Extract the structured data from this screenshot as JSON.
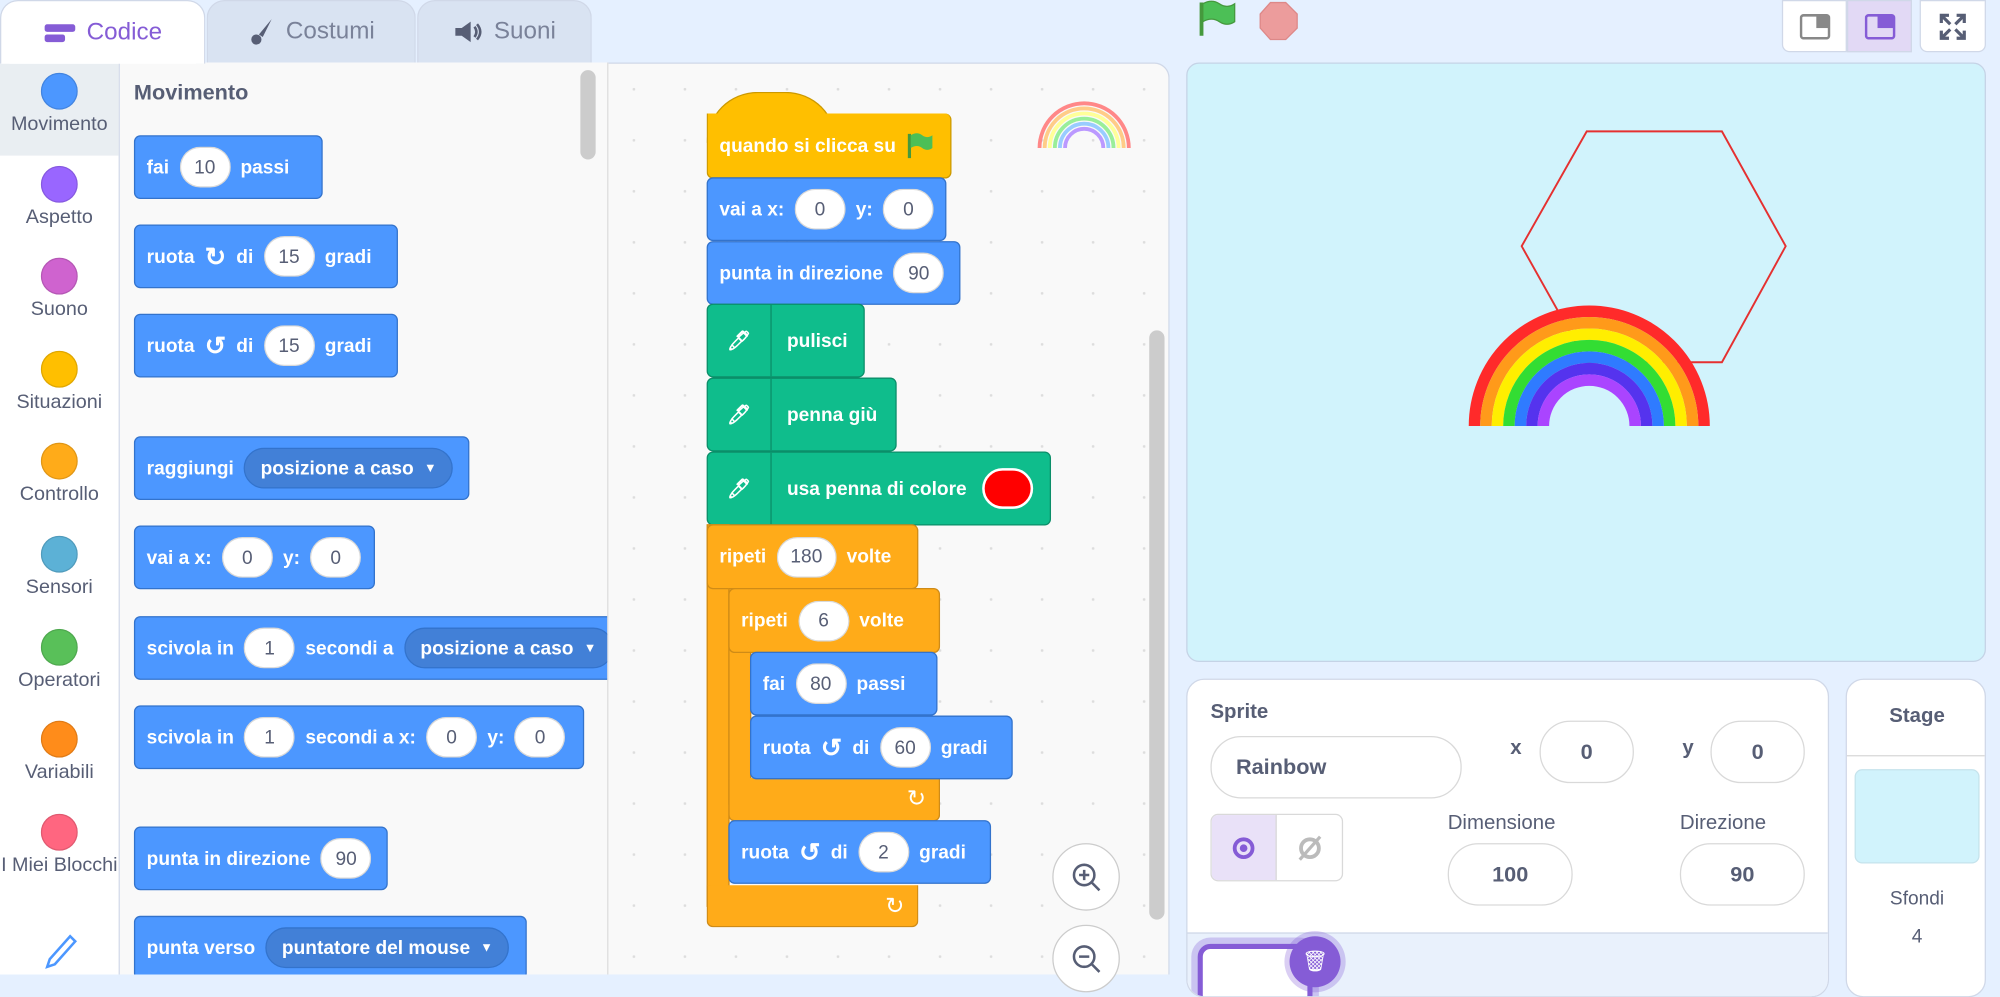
{
  "tabs": [
    {
      "label": "Codice",
      "icon": "code-icon"
    },
    {
      "label": "Costumi",
      "icon": "brush-icon"
    },
    {
      "label": "Suoni",
      "icon": "speaker-icon"
    }
  ],
  "categories": [
    {
      "label": "Movimento",
      "color": "#4c97ff"
    },
    {
      "label": "Aspetto",
      "color": "#9966ff"
    },
    {
      "label": "Suono",
      "color": "#cf63cf"
    },
    {
      "label": "Situazioni",
      "color": "#ffbf00"
    },
    {
      "label": "Controllo",
      "color": "#ffab19"
    },
    {
      "label": "Sensori",
      "color": "#5cb1d6"
    },
    {
      "label": "Operatori",
      "color": "#59c059"
    },
    {
      "label": "Variabili",
      "color": "#ff8c1a"
    },
    {
      "label": "I Miei Blocchi",
      "color": "#ff6680"
    }
  ],
  "palette": {
    "heading": "Movimento",
    "blocks": {
      "move": [
        "fai",
        "10",
        "passi"
      ],
      "turn_right": [
        "ruota",
        "di",
        "15",
        "gradi"
      ],
      "turn_left": [
        "ruota",
        "di",
        "15",
        "gradi"
      ],
      "goto": [
        "raggiungi",
        "posizione a caso"
      ],
      "goto_xy": [
        "vai a x:",
        "0",
        "y:",
        "0"
      ],
      "glide": [
        "scivola in",
        "1",
        "secondi a",
        "posizione a caso"
      ],
      "glide_xy": [
        "scivola in",
        "1",
        "secondi a x:",
        "0",
        "y:",
        "0"
      ],
      "point_dir": [
        "punta in direzione",
        "90"
      ],
      "point_towards": [
        "punta verso",
        "puntatore del mouse"
      ]
    }
  },
  "script": {
    "hat": "quando si clicca su",
    "goto": [
      "vai a x:",
      "0",
      "y:",
      "0"
    ],
    "point": [
      "punta in direzione",
      "90"
    ],
    "clear": "pulisci",
    "pendown": "penna giù",
    "pencolor": {
      "label": "usa penna di colore",
      "color": "#ff0000"
    },
    "repeat1": [
      "ripeti",
      "180",
      "volte"
    ],
    "repeat2": [
      "ripeti",
      "6",
      "volte"
    ],
    "move": [
      "fai",
      "80",
      "passi"
    ],
    "turn1": [
      "ruota",
      "di",
      "60",
      "gradi"
    ],
    "turn2": [
      "ruota",
      "di",
      "2",
      "gradi"
    ]
  },
  "sprite_info": {
    "sprite_label": "Sprite",
    "name": "Rainbow",
    "x_label": "x",
    "x": "0",
    "y_label": "y",
    "y": "0",
    "size_label": "Dimensione",
    "size": "100",
    "direction_label": "Direzione",
    "direction": "90"
  },
  "stage_panel": {
    "title": "Stage",
    "backdrops_label": "Sfondi",
    "backdrops_count": "4"
  },
  "colors": {
    "motion": "#4c97ff",
    "events": "#ffbf00",
    "control": "#ffab19",
    "pen": "#0fbd8c",
    "accent": "#855cd6",
    "stage_bg": "#d1f3fc"
  }
}
